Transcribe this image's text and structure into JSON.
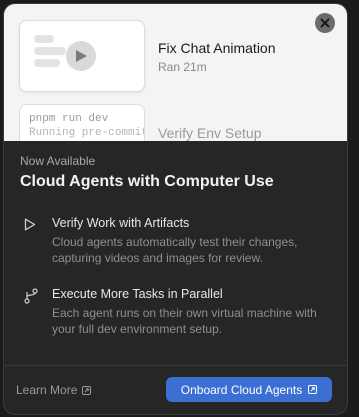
{
  "tasks": [
    {
      "title": "Fix Chat Animation",
      "meta": "Ran 21m"
    },
    {
      "title": "Verify Env Setup"
    }
  ],
  "terminal": {
    "line1": "pnpm run dev",
    "line2": "Running pre-commit"
  },
  "eyebrow": "Now Available",
  "heading": "Cloud Agents with Computer Use",
  "features": [
    {
      "icon": "play-outline-icon",
      "title": "Verify Work with Artifacts",
      "description": "Cloud agents automatically test their changes, capturing videos and images for review."
    },
    {
      "icon": "branch-icon",
      "title": "Execute More Tasks in Parallel",
      "description": "Each agent runs on their own virtual machine with your full dev environment setup."
    }
  ],
  "footer": {
    "learn_more": "Learn More",
    "onboard": "Onboard Cloud Agents"
  },
  "colors": {
    "accent": "#3b6fd1",
    "panel": "#262626",
    "hero": "#f4f4f4"
  }
}
